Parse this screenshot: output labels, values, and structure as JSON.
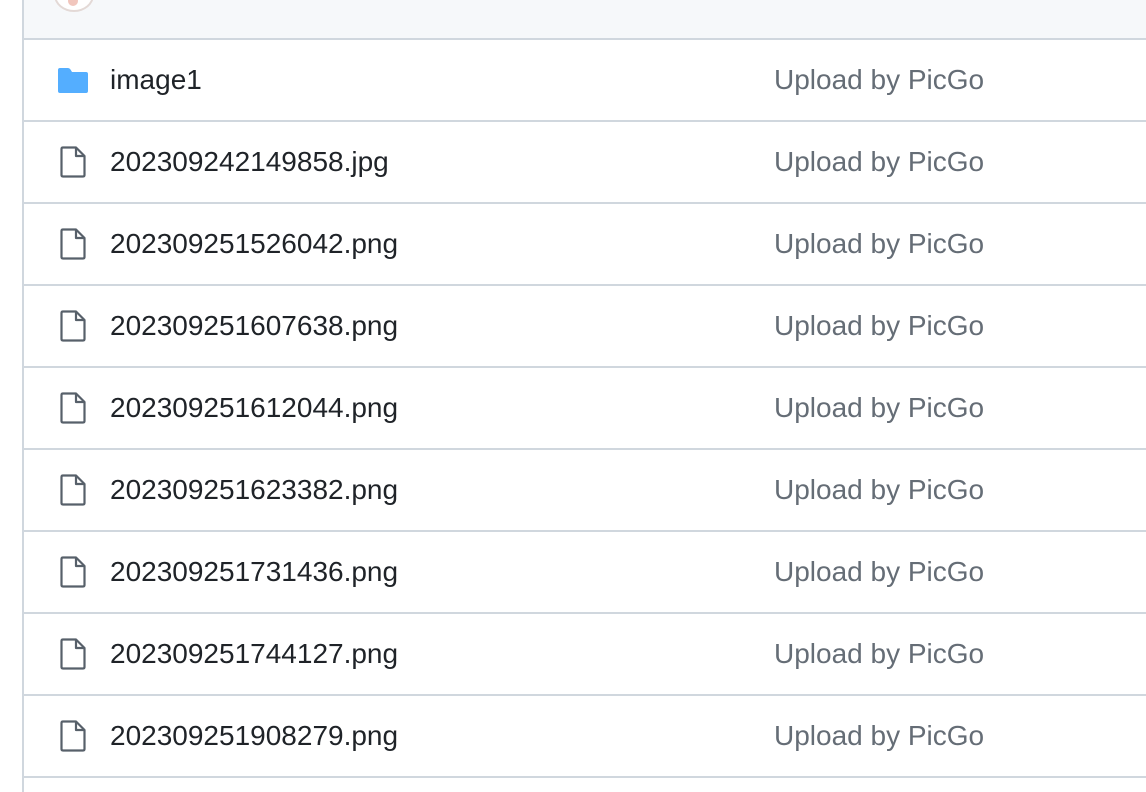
{
  "colors": {
    "folder_icon": "#54aeff",
    "file_icon": "#57606a",
    "name_text": "#1f2328",
    "message_text": "#656d76",
    "border": "#d0d7de"
  },
  "files": [
    {
      "type": "folder",
      "icon": "folder-icon",
      "name": "image1",
      "message": "Upload by PicGo"
    },
    {
      "type": "file",
      "icon": "file-icon",
      "name": "202309242149858.jpg",
      "message": "Upload by PicGo"
    },
    {
      "type": "file",
      "icon": "file-icon",
      "name": "202309251526042.png",
      "message": "Upload by PicGo"
    },
    {
      "type": "file",
      "icon": "file-icon",
      "name": "202309251607638.png",
      "message": "Upload by PicGo"
    },
    {
      "type": "file",
      "icon": "file-icon",
      "name": "202309251612044.png",
      "message": "Upload by PicGo"
    },
    {
      "type": "file",
      "icon": "file-icon",
      "name": "202309251623382.png",
      "message": "Upload by PicGo"
    },
    {
      "type": "file",
      "icon": "file-icon",
      "name": "202309251731436.png",
      "message": "Upload by PicGo"
    },
    {
      "type": "file",
      "icon": "file-icon",
      "name": "202309251744127.png",
      "message": "Upload by PicGo"
    },
    {
      "type": "file",
      "icon": "file-icon",
      "name": "202309251908279.png",
      "message": "Upload by PicGo"
    }
  ]
}
